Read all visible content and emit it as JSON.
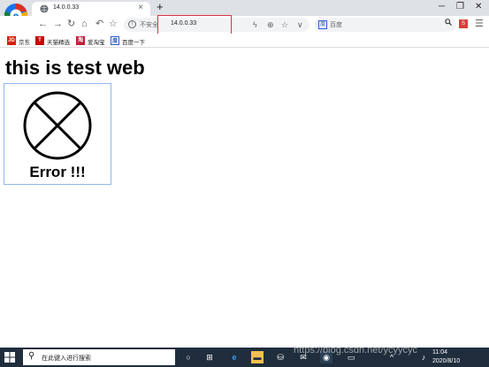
{
  "browser": {
    "tab_title": "14.0.0.33",
    "tab_close": "×",
    "new_tab": "+",
    "window_buttons": {
      "minimize": "─",
      "restore": "❐",
      "close": "✕"
    }
  },
  "toolbar": {
    "back": "←",
    "forward": "→",
    "reload": "↻",
    "home": "⌂",
    "undo": "↶",
    "star": "☆",
    "insecure_label": "不安全",
    "url": "14.0.0.33",
    "lightning": "ϟ",
    "zoom": "⊕",
    "bookmark_star": "☆",
    "dropdown": "∨",
    "search_placeholder": "百度",
    "search_engine_glyph": "度",
    "search_icon": "🔍",
    "menu": "☰"
  },
  "bookmarks": [
    {
      "label": "京东",
      "icon_text": "JD",
      "color": "#d81e06"
    },
    {
      "label": "天猫精选",
      "icon_text": "T",
      "color": "#c40000"
    },
    {
      "label": "爱淘宝",
      "icon_text": "淘",
      "color": "#c41e3a"
    },
    {
      "label": "百度一下",
      "icon_text": "度",
      "color": "#2f5bd0"
    }
  ],
  "page": {
    "heading": "this is test web",
    "error_text": "Error !!!"
  },
  "taskbar": {
    "search_placeholder": "在此键入进行搜索",
    "time": "11:04",
    "date": "2020/8/10"
  },
  "watermark": "https://blog.csdn.net/ycyycyc"
}
